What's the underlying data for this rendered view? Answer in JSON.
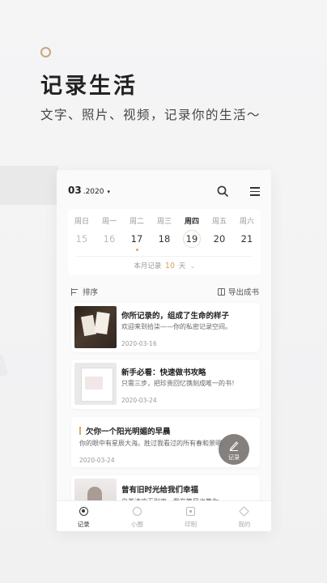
{
  "hero": {
    "title": "记录生活",
    "subtitle": "文字、照片、视频，记录你的生活～"
  },
  "app": {
    "header": {
      "month": "03",
      "year": ".2020"
    },
    "calendar": {
      "weekdays": [
        "周日",
        "周一",
        "周二",
        "周三",
        "周四",
        "周五",
        "周六"
      ],
      "dates": [
        "15",
        "16",
        "17",
        "18",
        "19",
        "20",
        "21"
      ],
      "active_weekday_index": 4,
      "today_index": 4,
      "dot_index": 2,
      "summary_prefix": "本月记录",
      "summary_count": "10",
      "summary_suffix": "天"
    },
    "toolbar": {
      "sort_label": "排序",
      "export_label": "导出成书"
    },
    "entries": [
      {
        "title": "你所记录的，组成了生命的样子",
        "desc": "欢迎来到拾柒——你的私密记录空间。",
        "date": "2020-03-16"
      },
      {
        "title": "新手必看：快速做书攻略",
        "desc": "只需三步，把珍贵回忆镌刻成唯一的书！",
        "date": "2020-03-24"
      },
      {
        "title": "欠你一个阳光明媚的早晨",
        "desc": "你的眼中有星辰大海。胜过我看过的所有春和景明",
        "date": "2020-03-24"
      },
      {
        "title": "曾有旧时光给我们幸福",
        "desc": "白茶清欢无别事，我在等风也等你"
      }
    ],
    "fab_label": "记录",
    "tabs": [
      "记录",
      "小圈",
      "印制",
      "我的"
    ],
    "accent_color": "#d4a15f"
  }
}
